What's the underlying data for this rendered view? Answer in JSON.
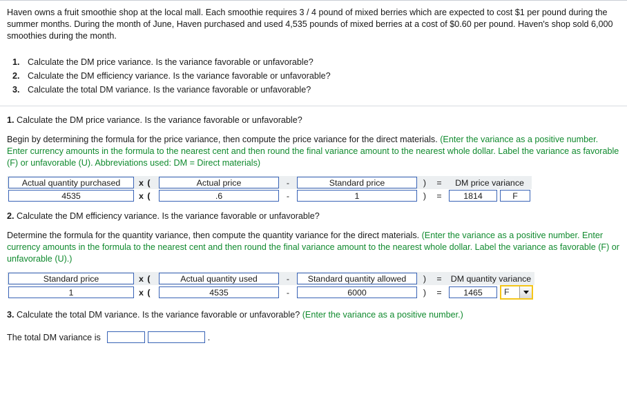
{
  "intro": {
    "paragraph": "Haven owns a fruit smoothie shop at the local mall. Each smoothie requires 3 / 4 pound of mixed berries which are expected to cost $1 per pound during the summer months. During the month of June, Haven purchased and used 4,535 pounds of mixed berries at a cost of $0.60 per pound. Haven's shop sold 6,000 smoothies during the month."
  },
  "question_list": [
    {
      "num": "1.",
      "text": "Calculate the DM price variance. Is the variance favorable or unfavorable?"
    },
    {
      "num": "2.",
      "text": "Calculate the DM efficiency variance. Is the variance favorable or unfavorable?"
    },
    {
      "num": "3.",
      "text": "Calculate the total DM variance. Is the variance favorable or unfavorable?"
    }
  ],
  "section1": {
    "number": "1.",
    "heading": "Calculate the DM price variance. Is the variance favorable or unfavorable?",
    "instruction_plain": "Begin by determining the formula for the price variance, then compute the price variance for the direct materials. ",
    "instruction_green": "(Enter the variance as a positive number. Enter currency amounts in the formula to the nearest cent and then round the final variance amount to the nearest whole dollar. Label the variance as favorable (F) or unfavorable (U). Abbreviations used: DM = Direct materials)",
    "table": {
      "headers": {
        "c1": "Actual quantity purchased",
        "op1": "x (",
        "c2": "Actual price",
        "op2": "-",
        "c3": "Standard price",
        "op3": ")",
        "op4": "=",
        "result_label": "DM price variance"
      },
      "values": {
        "c1": "4535",
        "op1": "x (",
        "c2": ".6",
        "op2": "-",
        "c3": "1",
        "op3": ")",
        "op4": "=",
        "result": "1814",
        "flag": "F"
      }
    }
  },
  "section2": {
    "number": "2.",
    "heading": "Calculate the DM efficiency variance. Is the variance favorable or unfavorable?",
    "instruction_plain": "Determine the formula for the quantity variance, then compute the quantity variance for the direct materials. ",
    "instruction_green": "(Enter the variance as a positive number. Enter currency amounts in the formula to the nearest cent and then round the final variance amount to the nearest whole dollar. Label the variance as favorable (F) or unfavorable (U).)",
    "table": {
      "headers": {
        "c1": "Standard price",
        "op1": "x (",
        "c2": "Actual quantity used",
        "op2": "-",
        "c3": "Standard quantity allowed",
        "op3": ")",
        "op4": "=",
        "result_label": "DM quantity variance"
      },
      "values": {
        "c1": "1",
        "op1": "x (",
        "c2": "4535",
        "op2": "-",
        "c3": "6000",
        "op3": ")",
        "op4": "=",
        "result": "1465",
        "flag": "F"
      }
    },
    "dropdown": {
      "selected": "F",
      "icon": "chevron-down-icon",
      "focus_color": "#f5c518"
    }
  },
  "section3": {
    "number": "3.",
    "heading": "Calculate the total DM variance. Is the variance favorable or unfavorable? ",
    "heading_green": "(Enter the variance as a positive number.)",
    "answer_label": "The total DM variance is",
    "answer_value": "",
    "answer_flag": "",
    "period": "."
  },
  "colors": {
    "green": "#108a2e",
    "input_border": "#3762b5",
    "header_bg": "#eceff1",
    "focus_gold": "#f5c518"
  }
}
